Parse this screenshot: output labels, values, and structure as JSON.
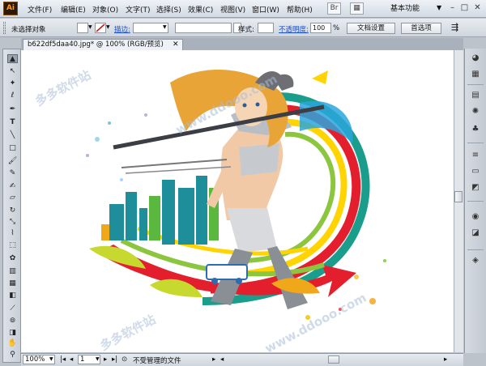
{
  "app": {
    "logo": "Ai"
  },
  "menu": {
    "items": [
      "文件(F)",
      "编辑(E)",
      "对象(O)",
      "文字(T)",
      "选择(S)",
      "效果(C)",
      "视图(V)",
      "窗口(W)",
      "帮助(H)"
    ]
  },
  "workspace": {
    "label": "基本功能"
  },
  "control": {
    "selection_label": "未选择对象",
    "stroke_label": "描边:",
    "style_label": "样式:",
    "opacity_label": "不透明度:",
    "opacity_value": "100",
    "opacity_unit": "%",
    "doc_setup": "文档设置",
    "preferences": "首选项"
  },
  "tab": {
    "title": "b622df5daa40.jpg* @ 100% (RGB/预览)"
  },
  "status": {
    "zoom": "100%",
    "artboard": "1",
    "info": "不受管理的文件"
  },
  "watermark": {
    "text_a": "多多软件站",
    "text_b": "www.ddooo.com"
  },
  "colors": {
    "accent": "#1a4fd0",
    "logo_bg": "#2b1a07",
    "logo_fg": "#ff9a1f"
  }
}
